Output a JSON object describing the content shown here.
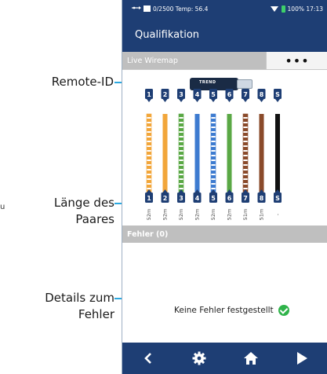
{
  "statusbar": {
    "storage": "0/2500",
    "temp": "Temp: 56.4",
    "battery": "100%",
    "time": "17:13"
  },
  "app_title": "Qualifikation",
  "wiremap": {
    "header": "Live Wiremap",
    "more_label": "•••",
    "remote_brand": "TREND",
    "wires": [
      {
        "top_id": "1",
        "bottom_id": "1",
        "length": "52m",
        "color": "#f2a63a",
        "striped": true
      },
      {
        "top_id": "2",
        "bottom_id": "2",
        "length": "52m",
        "color": "#f2a63a",
        "striped": false
      },
      {
        "top_id": "3",
        "bottom_id": "3",
        "length": "52m",
        "color": "#5aa845",
        "striped": true
      },
      {
        "top_id": "4",
        "bottom_id": "4",
        "length": "52m",
        "color": "#3d7bd0",
        "striped": false
      },
      {
        "top_id": "5",
        "bottom_id": "5",
        "length": "52m",
        "color": "#3d7bd0",
        "striped": true
      },
      {
        "top_id": "6",
        "bottom_id": "6",
        "length": "52m",
        "color": "#5aa845",
        "striped": false
      },
      {
        "top_id": "7",
        "bottom_id": "7",
        "length": "51m",
        "color": "#8a4a2a",
        "striped": true
      },
      {
        "top_id": "8",
        "bottom_id": "8",
        "length": "51m",
        "color": "#8a4a2a",
        "striped": false
      },
      {
        "top_id": "S",
        "bottom_id": "S",
        "length": "-",
        "color": "#111111",
        "striped": false
      }
    ]
  },
  "errors": {
    "header": "Fehler (0)",
    "message": "Keine Fehler festgestellt"
  },
  "callouts": {
    "remote_id": "Remote-ID",
    "pair_length_1": "Länge des",
    "pair_length_2": "Paares",
    "details_1": "Details zum",
    "details_2": "Fehler",
    "stray_char": "u"
  },
  "colors": {
    "navy": "#1e3e74",
    "accent": "#2ba8e0",
    "ok_green": "#2fb34a"
  }
}
